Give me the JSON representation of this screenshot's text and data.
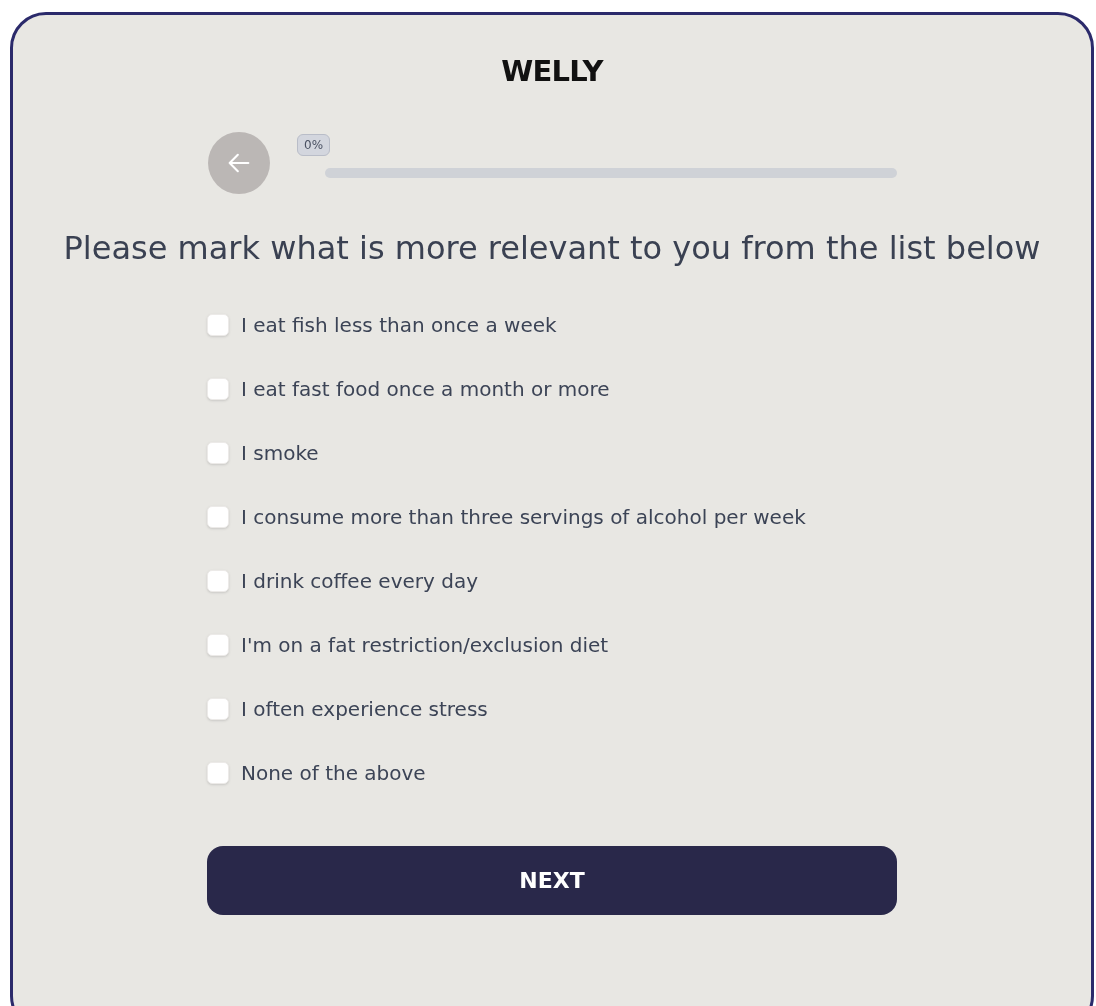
{
  "brand": "WELLY",
  "progress": {
    "label": "0%",
    "level": 0
  },
  "question": "Please mark what is more relevant to you from the list below",
  "options": [
    {
      "label": "I eat fish less than once a week",
      "checked": false
    },
    {
      "label": "I eat fast food once a month or more",
      "checked": false
    },
    {
      "label": "I smoke",
      "checked": false
    },
    {
      "label": "I consume more than three servings of alcohol per week",
      "checked": false
    },
    {
      "label": "I drink coffee every day",
      "checked": false
    },
    {
      "label": "I'm on a fat restriction/exclusion diet",
      "checked": false
    },
    {
      "label": "I often experience stress",
      "checked": false
    },
    {
      "label": "None of the above",
      "checked": false
    }
  ],
  "next_button": "NEXT"
}
